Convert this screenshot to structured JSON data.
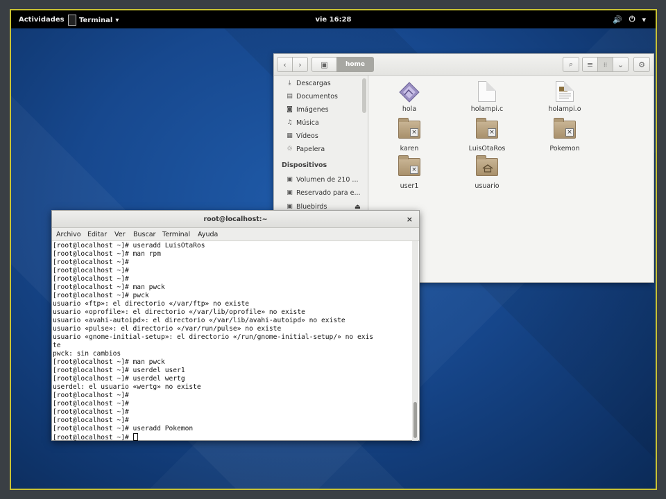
{
  "topbar": {
    "activities": "Actividades",
    "app_menu": "Terminal",
    "app_menu_arrow": "▾",
    "clock": "vie 16:28",
    "volume_icon": "🔊",
    "power_icon": "⏻",
    "tray_arrow": "▾"
  },
  "files": {
    "back": "‹",
    "forward": "›",
    "path_root_icon": "▣",
    "path_current": "home",
    "search_icon": "⌕",
    "list_view_icon": "≡",
    "grid_view_icon": "⁞⁞",
    "view_menu_icon": "⌄",
    "settings_icon": "⚙",
    "sidebar": {
      "places": [
        {
          "icon": "⤓",
          "label": "Descargas"
        },
        {
          "icon": "▤",
          "label": "Documentos"
        },
        {
          "icon": "◙",
          "label": "Imágenes"
        },
        {
          "icon": "♫",
          "label": "Música"
        },
        {
          "icon": "▦",
          "label": "Vídeos"
        },
        {
          "icon": "♲",
          "label": "Papelera"
        }
      ],
      "devices_heading": "Dispositivos",
      "devices": [
        {
          "icon": "▣",
          "label": "Volumen de 210 ..."
        },
        {
          "icon": "▣",
          "label": "Reservado para e..."
        },
        {
          "icon": "▣",
          "label": "Bluebirds",
          "eject": "⏏"
        }
      ]
    },
    "items": [
      {
        "name": "hola",
        "kind": "image"
      },
      {
        "name": "holampi.c",
        "kind": "doc"
      },
      {
        "name": "holampi.o",
        "kind": "doc2"
      },
      {
        "name": "karen",
        "kind": "folder-locked"
      },
      {
        "name": "LuisOtaRos",
        "kind": "folder-locked"
      },
      {
        "name": "Pokemon",
        "kind": "folder-locked"
      },
      {
        "name": "user1",
        "kind": "folder-locked"
      },
      {
        "name": "usuario",
        "kind": "home-folder"
      }
    ]
  },
  "terminal": {
    "title": "root@localhost:~",
    "close": "×",
    "menu": [
      "Archivo",
      "Editar",
      "Ver",
      "Buscar",
      "Terminal",
      "Ayuda"
    ],
    "lines": [
      "[root@localhost ~]# useradd LuisOtaRos",
      "[root@localhost ~]# man rpm",
      "[root@localhost ~]#",
      "[root@localhost ~]#",
      "[root@localhost ~]#",
      "[root@localhost ~]# man pwck",
      "[root@localhost ~]# pwck",
      "usuario «ftp»: el directorio «/var/ftp» no existe",
      "usuario «oprofile»: el directorio «/var/lib/oprofile» no existe",
      "usuario «avahi-autoipd»: el directorio «/var/lib/avahi-autoipd» no existe",
      "usuario «pulse»: el directorio «/var/run/pulse» no existe",
      "usuario «gnome-initial-setup»: el directorio «/run/gnome-initial-setup/» no exis",
      "te",
      "pwck: sin cambios",
      "[root@localhost ~]# man pwck",
      "[root@localhost ~]# userdel user1",
      "[root@localhost ~]# userdel wertg",
      "userdel: el usuario «wertg» no existe",
      "[root@localhost ~]#",
      "[root@localhost ~]#",
      "[root@localhost ~]#",
      "[root@localhost ~]#",
      "[root@localhost ~]# useradd Pokemon"
    ],
    "prompt": "[root@localhost ~]# "
  }
}
